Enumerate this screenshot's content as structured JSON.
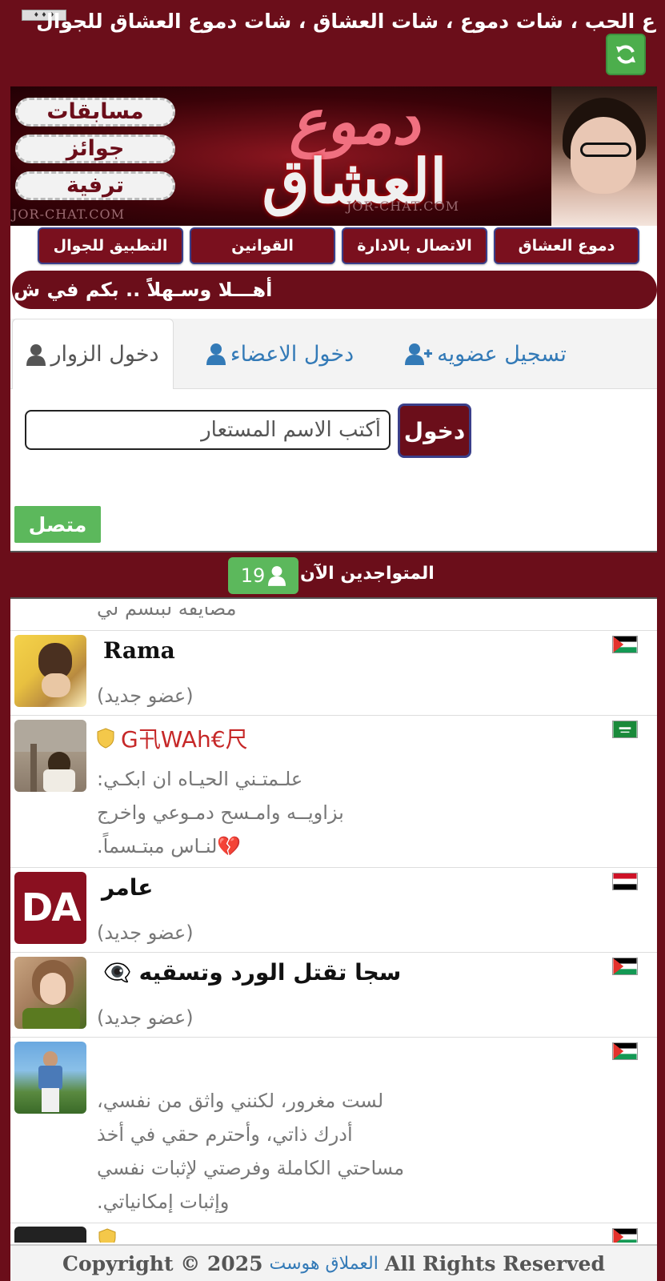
{
  "header": {
    "marquee": "ع الحب ، شات دموع ، شات العشاق ، شات دموع العشاق للجوال",
    "refresh_icon": "refresh-icon"
  },
  "banner": {
    "pills": [
      "مسابقات",
      "جوائز",
      "ترفية"
    ],
    "title_line1": "دموع",
    "title_line2": "العشاق",
    "watermark": "JOR-CHAT.COM"
  },
  "nav": {
    "items": [
      "دموع العشاق",
      "الاتصال بالادارة",
      "القوانين",
      "التطبيق للجوال"
    ]
  },
  "welcome": "أهـــلا وسـهلاً .. بكم في ش",
  "tabs": {
    "guest": "دخول الزوار",
    "members": "دخول الاعضاء",
    "register": "تسجيل عضويه"
  },
  "login": {
    "placeholder": "أكتب الاسم المستعار",
    "enter": "دخول",
    "online_button": "متصل"
  },
  "online": {
    "label": "المتواجدين الآن",
    "count": "19"
  },
  "users": {
    "partial_text": "مصايفه لبتسم لي",
    "rows": [
      {
        "name": "Rama",
        "status": "(عضو جديد)",
        "flag": "palestine"
      },
      {
        "name": "G卂WAh€尺",
        "status_lines": [
          "علـمتـني الحيـاه ان ابكـي:",
          "بزاويــه وامـسح دمـوعي واخرج",
          "💔لنـاس مبتـسماً."
        ],
        "flag": "saudi-arabia"
      },
      {
        "name": "عامر",
        "status": "(عضو جديد)",
        "flag": "yemen",
        "avatar_text": "DA"
      },
      {
        "name": "سجا تقتل الورد وتسقيه",
        "status": "(عضو جديد)",
        "flag": "palestine"
      },
      {
        "name": "",
        "status_lines": [
          "لست مغرور، لكنني واثق من نفسي،",
          "أدرك ذاتي، وأحترم حقي في أخذ",
          "مساحتي الكاملة وفرصتي لإثبات نفسي",
          "وإثبات إمكانياتي."
        ],
        "flag": "palestine"
      }
    ]
  },
  "footer": {
    "copyright": "Copyright © 2025",
    "brand": "العملاق هوست",
    "rights": "All Rights Reserved"
  }
}
